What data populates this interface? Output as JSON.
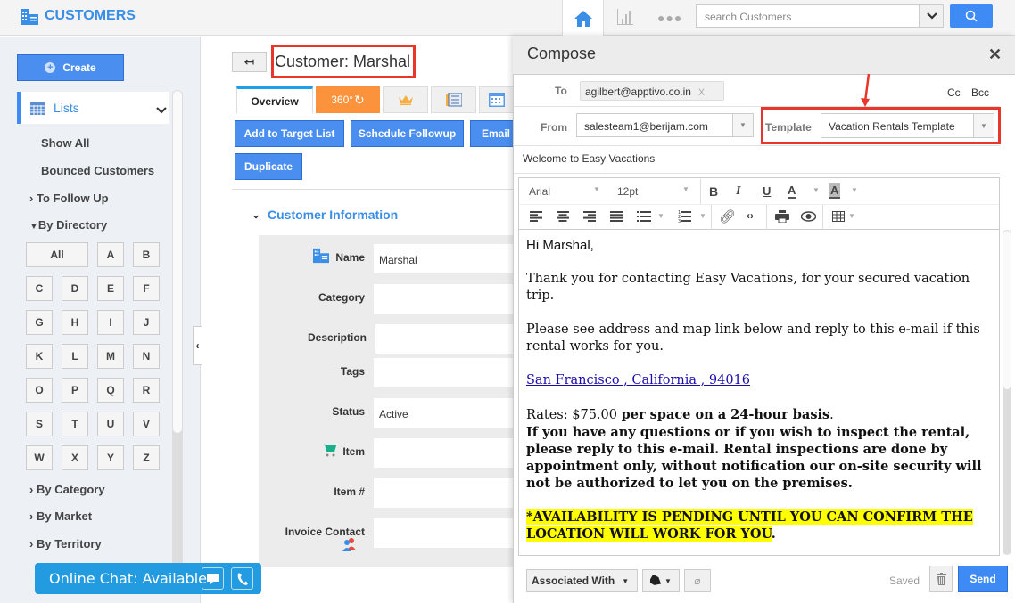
{
  "app": {
    "title": "CUSTOMERS",
    "icon": "building-icon"
  },
  "topnav": {
    "home_icon": "home-icon",
    "reports_icon": "bar-chart-icon",
    "more_icon": "ellipsis-icon",
    "search_placeholder": "search Customers",
    "search_icon": "search-icon"
  },
  "sidebar": {
    "create_label": "Create",
    "lists_label": "Lists",
    "links": [
      "Show All",
      "Bounced Customers"
    ],
    "groups": {
      "to_follow_up": "To Follow Up",
      "by_directory": "By Directory",
      "by_category": "By Category",
      "by_market": "By Market",
      "by_territory": "By Territory"
    },
    "letters": [
      "All",
      "A",
      "B",
      "C",
      "D",
      "E",
      "F",
      "G",
      "H",
      "I",
      "J",
      "K",
      "L",
      "M",
      "N",
      "O",
      "P",
      "Q",
      "R",
      "S",
      "T",
      "U",
      "V",
      "W",
      "X",
      "Y",
      "Z"
    ]
  },
  "main": {
    "back_icon": "back-arrow-icon",
    "page_title": "Customer: Marshal",
    "tabs": [
      {
        "label": "Overview",
        "active": true
      },
      {
        "label": "360°",
        "icon": "refresh-icon"
      },
      {
        "label": "",
        "icon": "crown-icon"
      },
      {
        "label": "",
        "icon": "form-icon"
      },
      {
        "label": "",
        "icon": "calendar-icon"
      }
    ],
    "actions": [
      "Add to Target List",
      "Schedule Followup",
      "Email",
      "Duplicate"
    ],
    "section_title": "Customer Information",
    "fields": [
      {
        "label": "Name",
        "value": "Marshal",
        "icon": "building-icon"
      },
      {
        "label": "Category",
        "value": ""
      },
      {
        "label": "Description",
        "value": ""
      },
      {
        "label": "Tags",
        "value": ""
      },
      {
        "label": "Status",
        "value": "Active"
      },
      {
        "label": "Item",
        "value": "",
        "icon": "cart-icon"
      },
      {
        "label": "Item #",
        "value": ""
      },
      {
        "label": "Invoice Contact",
        "value": "",
        "icon": "contacts-icon"
      }
    ]
  },
  "chat": {
    "label": "Online Chat: Available"
  },
  "compose": {
    "title": "Compose",
    "to_label": "To",
    "to_value": "agilbert@apptivo.co.in",
    "cc_label": "Cc",
    "bcc_label": "Bcc",
    "from_label": "From",
    "from_value": "salesteam1@berijam.com",
    "template_label": "Template",
    "template_value": "Vacation Rentals Template",
    "subject": "Welcome to Easy Vacations",
    "toolbar": {
      "font": "Arial",
      "size": "12pt"
    },
    "body": {
      "greeting": "Hi Marshal,",
      "p1": "Thank you for contacting Easy Vacations, for your secured vacation trip.",
      "p2": "Please see address and map link below and reply to this e-mail if this rental works for you.",
      "link": "San Francisco , California , 94016",
      "rates_prefix": "Rates: $75.00 ",
      "rates_bold": "per space on a 24-hour basis",
      "rates_suffix": ".",
      "p3": "If you have any questions or if you wish to inspect the rental, please reply to this e-mail. Rental inspections are done by appointment only, without notification our on-site security will not be authorized to let you on the premises.",
      "highlight": "*AVAILABILITY IS PENDING UNTIL YOU CAN CONFIRM THE LOCATION WILL WORK FOR YOU",
      "highlight_suffix": "."
    },
    "footer": {
      "associated_label": "Associated With",
      "saved_label": "Saved",
      "send_label": "Send"
    }
  }
}
